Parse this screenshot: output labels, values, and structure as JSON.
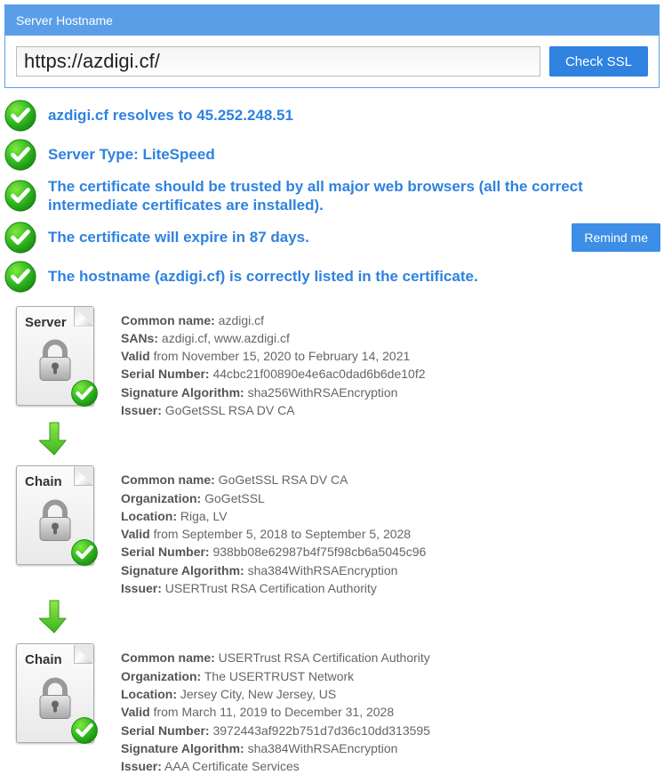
{
  "panel": {
    "title": "Server Hostname"
  },
  "input": {
    "value": "https://azdigi.cf/"
  },
  "buttons": {
    "check": "Check SSL",
    "remind": "Remind me"
  },
  "status": {
    "resolves": "azdigi.cf resolves to 45.252.248.51",
    "server_type": "Server Type: LiteSpeed",
    "trusted": "The certificate should be trusted by all major web browsers (all the correct intermediate certificates are installed).",
    "expire": "The certificate will expire in 87 days.",
    "hostname": "The hostname (azdigi.cf) is correctly listed in the certificate."
  },
  "labels": {
    "server": "Server",
    "chain": "Chain",
    "cn": "Common name:",
    "sans": "SANs:",
    "org": "Organization:",
    "loc": "Location:",
    "valid": "Valid",
    "serial": "Serial Number:",
    "sigalg": "Signature Algorithm:",
    "issuer": "Issuer:"
  },
  "certs": [
    {
      "tag": "Server",
      "cn": "azdigi.cf",
      "sans": "azdigi.cf, www.azdigi.cf",
      "valid": " from November 15, 2020 to February 14, 2021",
      "serial": "44cbc21f00890e4e6ac0dad6b6de10f2",
      "sigalg": "sha256WithRSAEncryption",
      "issuer": "GoGetSSL RSA DV CA"
    },
    {
      "tag": "Chain",
      "cn": "GoGetSSL RSA DV CA",
      "org": "GoGetSSL",
      "loc": "Riga, LV",
      "valid": " from September 5, 2018 to September 5, 2028",
      "serial": "938bb08e62987b4f75f98cb6a5045c96",
      "sigalg": "sha384WithRSAEncryption",
      "issuer": "USERTrust RSA Certification Authority"
    },
    {
      "tag": "Chain",
      "cn": "USERTrust RSA Certification Authority",
      "org": "The USERTRUST Network",
      "loc": "Jersey City, New Jersey, US",
      "valid": " from March 11, 2019 to December 31, 2028",
      "serial": "3972443af922b751d7d36c10dd313595",
      "sigalg": "sha384WithRSAEncryption",
      "issuer": "AAA Certificate Services"
    }
  ]
}
